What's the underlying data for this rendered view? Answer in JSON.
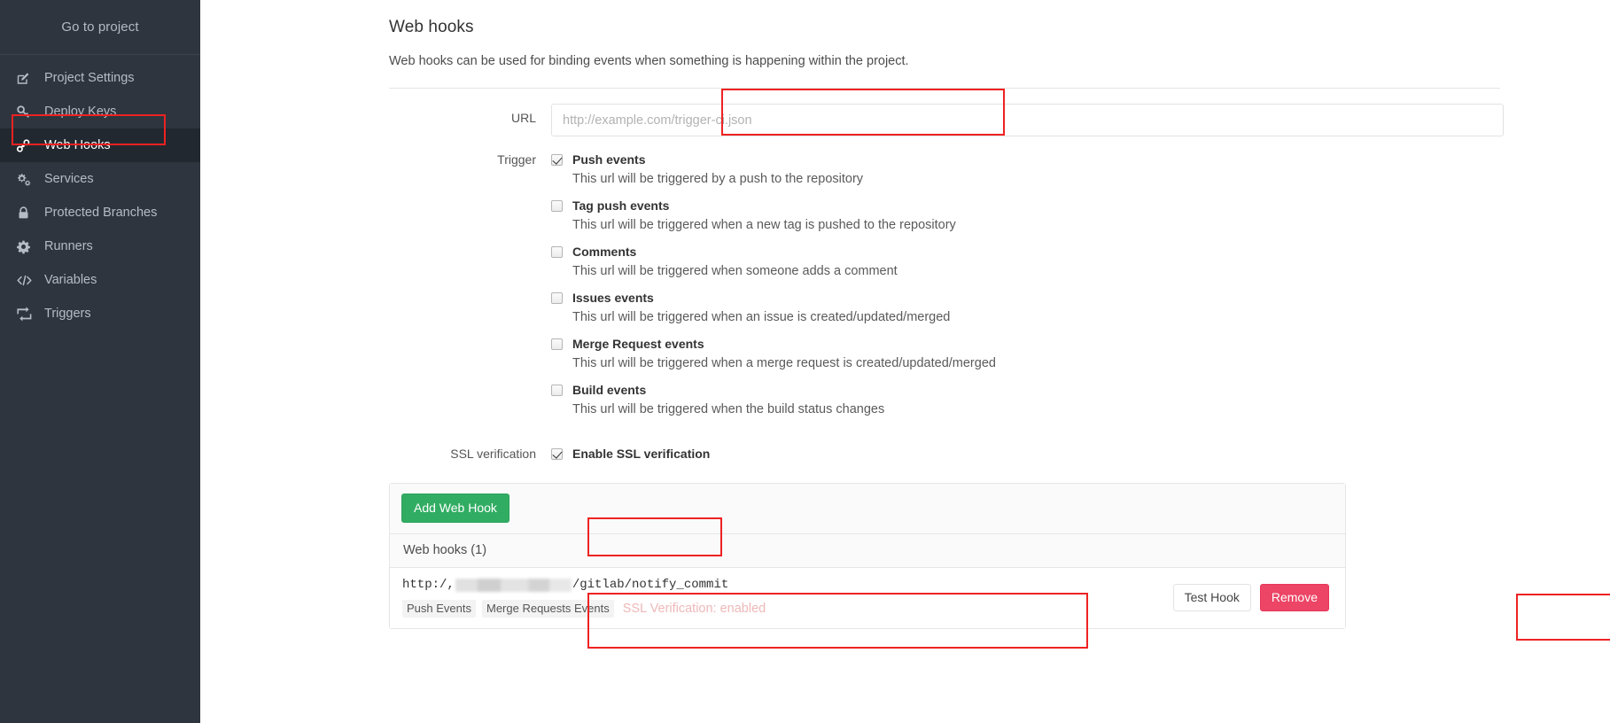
{
  "sidebar": {
    "go_to_project": "Go to project",
    "items": [
      {
        "label": "Project Settings",
        "icon": "edit-square-icon",
        "active": false
      },
      {
        "label": "Deploy Keys",
        "icon": "key-icon",
        "active": false
      },
      {
        "label": "Web Hooks",
        "icon": "link-hooks-icon",
        "active": true
      },
      {
        "label": "Services",
        "icon": "gears-icon",
        "active": false
      },
      {
        "label": "Protected Branches",
        "icon": "lock-icon",
        "active": false
      },
      {
        "label": "Runners",
        "icon": "gear-icon",
        "active": false
      },
      {
        "label": "Variables",
        "icon": "code-icon",
        "active": false
      },
      {
        "label": "Triggers",
        "icon": "retweet-icon",
        "active": false
      }
    ]
  },
  "page": {
    "title": "Web hooks",
    "description": "Web hooks can be used for binding events when something is happening within the project."
  },
  "form": {
    "url_label": "URL",
    "url_value": "",
    "url_placeholder": "http://example.com/trigger-ci.json",
    "trigger_label": "Trigger",
    "triggers": [
      {
        "label": "Push events",
        "desc": "This url will be triggered by a push to the repository",
        "checked": true
      },
      {
        "label": "Tag push events",
        "desc": "This url will be triggered when a new tag is pushed to the repository",
        "checked": false
      },
      {
        "label": "Comments",
        "desc": "This url will be triggered when someone adds a comment",
        "checked": false
      },
      {
        "label": "Issues events",
        "desc": "This url will be triggered when an issue is created/updated/merged",
        "checked": false
      },
      {
        "label": "Merge Request events",
        "desc": "This url will be triggered when a merge request is created/updated/merged",
        "checked": false
      },
      {
        "label": "Build events",
        "desc": "This url will be triggered when the build status changes",
        "checked": false
      }
    ],
    "ssl_label": "SSL verification",
    "ssl_checkbox_label": "Enable SSL verification",
    "ssl_checked": true,
    "add_button": "Add Web Hook"
  },
  "hooks_panel": {
    "heading": "Web hooks (1)",
    "rows": [
      {
        "url_prefix": "http:/,",
        "url_suffix": "/gitlab/notify_commit",
        "badges": [
          "Push Events",
          "Merge Requests Events"
        ],
        "ssl_note": "SSL Verification: enabled",
        "test_button": "Test Hook",
        "remove_button": "Remove"
      }
    ]
  },
  "colors": {
    "sidebar_bg": "#2e353e",
    "sidebar_active_bg": "#22282f",
    "annotation_red": "#ee2222",
    "add_button_green": "#31ad63",
    "remove_button_pink": "#ec4565"
  }
}
